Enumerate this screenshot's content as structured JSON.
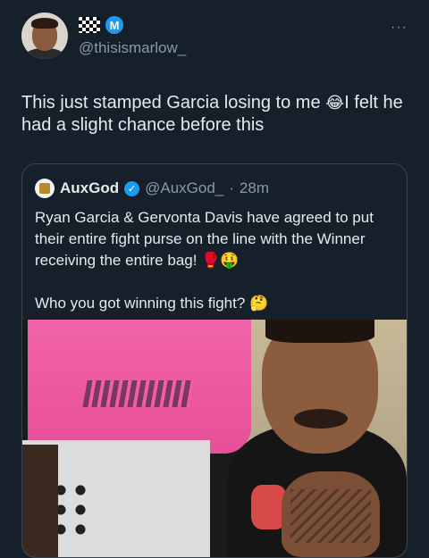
{
  "author": {
    "handle": "@thisismarlow_",
    "badge_letter": "M",
    "icons": [
      "checkered-flag-icon",
      "m-badge-icon"
    ]
  },
  "menu": {
    "more_label": "···"
  },
  "tweet": {
    "text": "This just stamped Garcia losing to me ",
    "emoji": "😂",
    "text_after": "I felt he had a slight chance before this"
  },
  "quote": {
    "name": "AuxGod",
    "handle": "@AuxGod_",
    "separator": "·",
    "time": "28m",
    "verified_mark": "✓",
    "text_1": "Ryan Garcia & Gervonta Davis have agreed to put their entire fight purse on the line with the Winner receiving the entire bag! ",
    "text_1_emoji": "🥊🤑",
    "text_2": "Who you got winning this fight? ",
    "text_2_emoji": "🤔"
  },
  "colors": {
    "background": "#15202b",
    "text": "#e7e9ea",
    "muted": "#8b98a5",
    "accent": "#1d9bf0",
    "border": "#38444d"
  }
}
